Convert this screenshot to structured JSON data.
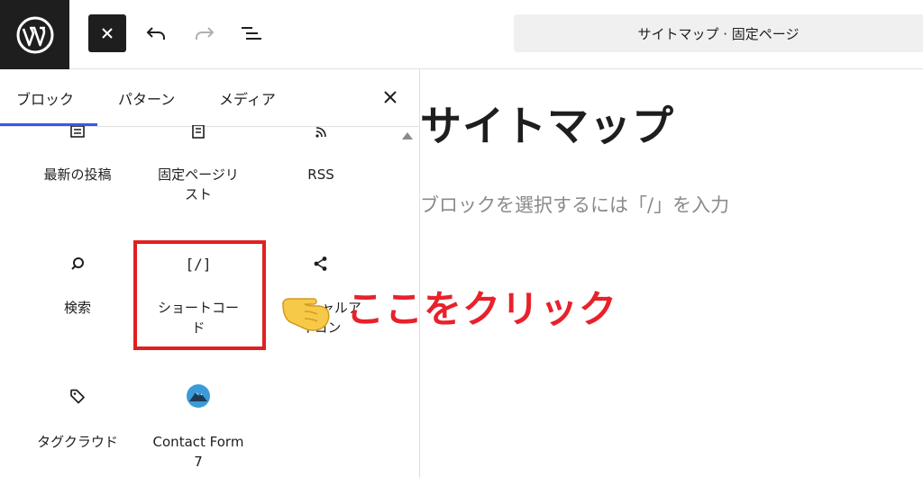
{
  "header": {
    "doc_title": "サイトマップ · 固定ページ"
  },
  "inserter": {
    "tabs": [
      {
        "label": "ブロック"
      },
      {
        "label": "パターン"
      },
      {
        "label": "メディア"
      }
    ],
    "blocks": [
      {
        "label": "最新の投稿",
        "icon": "latest-posts-icon"
      },
      {
        "label": "固定ページリ\nスト",
        "icon": "page-list-icon"
      },
      {
        "label": "RSS",
        "icon": "rss-icon"
      },
      {
        "label": "検索",
        "icon": "search-icon"
      },
      {
        "label": "ショートコー\nド",
        "icon_glyph": "[/]",
        "icon": "shortcode-icon"
      },
      {
        "label": "ソーシャルア\nイコン",
        "icon": "share-icon"
      },
      {
        "label": "タグクラウド",
        "icon": "tag-icon"
      },
      {
        "label": "Contact Form\n7",
        "icon": "contact-form-7-icon"
      }
    ]
  },
  "editor": {
    "page_title": "サイトマップ",
    "placeholder": "ブロックを選択するには「/」を入力"
  },
  "annotation": {
    "text": "ここをクリック",
    "color": "#e8212b"
  },
  "colors": {
    "accent": "#3858e9",
    "highlight": "#e02020"
  }
}
